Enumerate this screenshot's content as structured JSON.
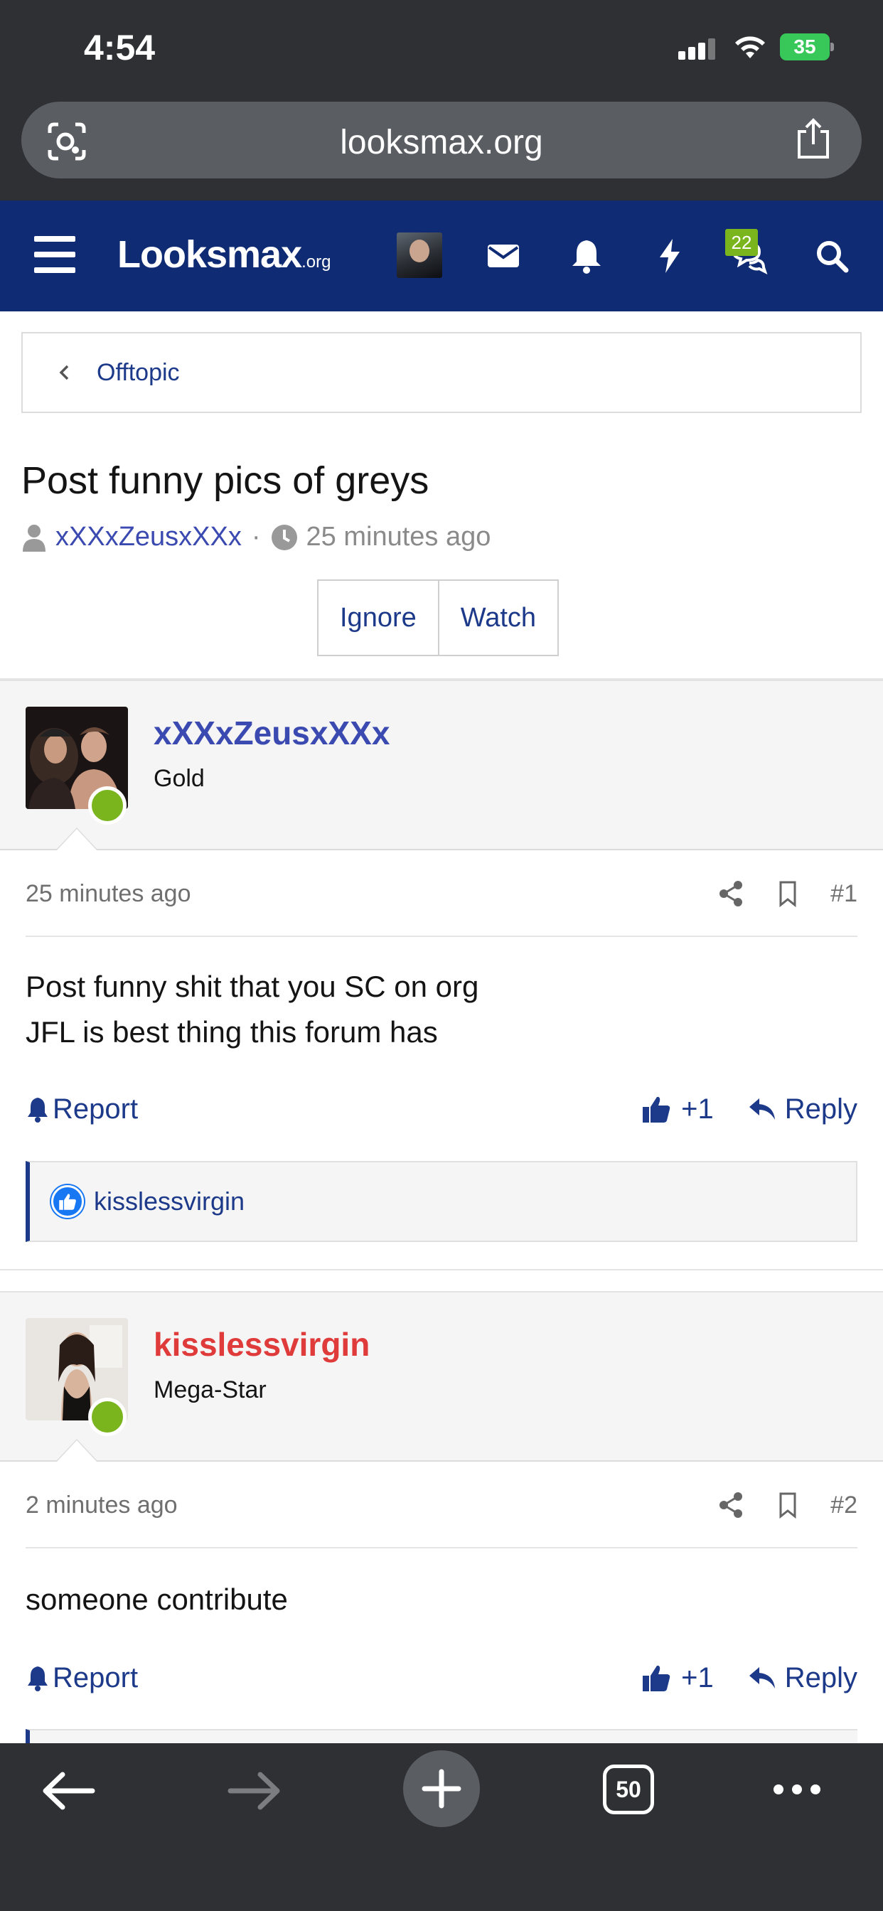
{
  "status_bar": {
    "time": "4:54",
    "battery": "35"
  },
  "browser": {
    "url": "looksmax.org",
    "tabs_count": "50"
  },
  "site_header": {
    "logo_main": "Looksmax",
    "logo_suffix": ".org",
    "conversations_badge": "22"
  },
  "breadcrumb": {
    "label": "Offtopic"
  },
  "thread": {
    "title": "Post funny pics of greys",
    "author": "xXXxZeusxXXx",
    "time": "25 minutes ago",
    "buttons": {
      "ignore": "Ignore",
      "watch": "Watch"
    }
  },
  "posts": [
    {
      "username": "xXXxZeusxXXx",
      "username_color": "#3b4ab0",
      "rank": "Gold",
      "time": "25 minutes ago",
      "number": "#1",
      "body": [
        "Post funny shit that you SC on org",
        "JFL is best thing this forum has"
      ],
      "report_label": "Report",
      "like_count": "+1",
      "reply_label": "Reply",
      "reactions": "kisslessvirgin"
    },
    {
      "username": "kisslessvirgin",
      "username_color": "#e03b3b",
      "rank": "Mega-Star",
      "time": "2 minutes ago",
      "number": "#2",
      "body": [
        "someone contribute"
      ],
      "report_label": "Report",
      "like_count": "+1",
      "reply_label": "Reply"
    }
  ],
  "colors": {
    "header_bg": "#0f2b73",
    "link": "#1d3a8a",
    "online": "#7ab51d",
    "browser_chrome": "#2e3034"
  },
  "icons": {
    "header": [
      "menu-icon",
      "avatar",
      "envelope-icon",
      "bell-icon",
      "bolt-icon",
      "conversations-icon",
      "search-icon"
    ],
    "toolbar": [
      "back-arrow-icon",
      "forward-arrow-icon",
      "plus-icon",
      "tabs-icon",
      "more-icon"
    ]
  }
}
